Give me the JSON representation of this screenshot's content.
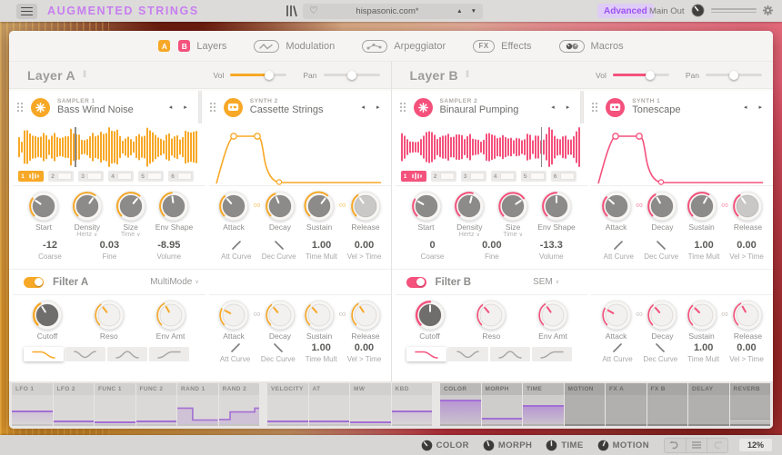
{
  "topbar": {
    "title": "AUGMENTED STRINGS",
    "menu_icon": "hamburger-icon",
    "library_icon": "library-icon",
    "preset": {
      "heart_icon": "heart-icon",
      "name": "hispasonic.com*"
    },
    "advanced_label": "Advanced",
    "main_out_label": "Main Out",
    "settings_icon": "gear-icon"
  },
  "tabs": [
    {
      "label": "Layers",
      "icon": "layers-ab-icon",
      "active": true
    },
    {
      "label": "Modulation",
      "icon": "modulation-icon",
      "active": false
    },
    {
      "label": "Arpeggiator",
      "icon": "arpeggiator-icon",
      "active": false
    },
    {
      "label": "Effects",
      "icon": "effects-fx-icon",
      "active": false
    },
    {
      "label": "Macros",
      "icon": "macros-icon",
      "active": false
    }
  ],
  "layers": {
    "a": {
      "accent": "#F7A827",
      "title": "Layer A",
      "vol_label": "Vol",
      "vol": 0.68,
      "pan_label": "Pan",
      "pan": 0.5,
      "sampler": {
        "type_label": "SAMPLER 1",
        "name": "Bass Wind Noise"
      },
      "synth": {
        "type_label": "SYNTH 2",
        "name": "Cassette Strings"
      },
      "playhead": 0.31,
      "slot_labels": [
        "1",
        "2",
        "3",
        "4",
        "5",
        "6"
      ],
      "selected_slot": 0,
      "main_knobs": [
        {
          "label": "Start",
          "angle": -55
        },
        {
          "label": "Density",
          "sub": "Hertz",
          "angle": 35
        },
        {
          "label": "Size",
          "sub": "Time",
          "angle": 40
        },
        {
          "label": "Env Shape",
          "angle": -8
        }
      ],
      "env_knobs": [
        {
          "label": "Attack",
          "angle": -42
        },
        {
          "label": "Decay",
          "angle": -22
        },
        {
          "label": "Sustain",
          "angle": 38
        },
        {
          "label": "Release",
          "angle": -35,
          "kind": "pale"
        }
      ],
      "values_left": [
        {
          "value": "-12",
          "label": "Coarse"
        },
        {
          "value": "0.03",
          "label": "Fine"
        },
        {
          "value": "-8.95",
          "label": "Volume"
        }
      ],
      "values_right": [
        {
          "glyph": "rise",
          "label": "Att Curve"
        },
        {
          "glyph": "fall",
          "label": "Dec Curve"
        },
        {
          "value": "1.00",
          "label": "Time Mult"
        },
        {
          "value": "0.00",
          "label": "Vel > Time"
        }
      ],
      "filter": {
        "label": "Filter A",
        "enabled": true,
        "mode": "MultiMode",
        "shapes": [
          "lowpass",
          "notch",
          "bandpass",
          "highpass"
        ],
        "selected_shape": 0,
        "knobs": [
          {
            "label": "Cutoff",
            "angle": -32,
            "kind": "cutoff"
          },
          {
            "label": "Reso",
            "angle": -38,
            "kind": "light"
          },
          {
            "label": "Env Amt",
            "angle": -30,
            "kind": "light"
          }
        ],
        "env_knobs": [
          {
            "label": "Attack",
            "angle": -62,
            "kind": "light"
          },
          {
            "label": "Decay",
            "angle": -40,
            "kind": "light"
          },
          {
            "label": "Sustain",
            "angle": -42,
            "kind": "light"
          },
          {
            "label": "Release",
            "angle": -33,
            "kind": "light"
          }
        ],
        "values": [
          {
            "glyph": "rise",
            "label": "Att Curve"
          },
          {
            "glyph": "fall",
            "label": "Dec Curve"
          },
          {
            "value": "1.00",
            "label": "Time Mult"
          },
          {
            "value": "0.00",
            "label": "Vel > Time"
          }
        ]
      }
    },
    "b": {
      "accent": "#F4517C",
      "title": "Layer B",
      "vol_label": "Vol",
      "vol": 0.66,
      "pan_label": "Pan",
      "pan": 0.5,
      "sampler": {
        "type_label": "SAMPLER 2",
        "name": "Binaural Pumping"
      },
      "synth": {
        "type_label": "SYNTH 1",
        "name": "Tonescape"
      },
      "playhead": 0.77,
      "slot_labels": [
        "1",
        "2",
        "3",
        "4",
        "5",
        "6"
      ],
      "selected_slot": 0,
      "main_knobs": [
        {
          "label": "Start",
          "angle": -60
        },
        {
          "label": "Density",
          "sub": "Hertz",
          "angle": 15
        },
        {
          "label": "Size",
          "sub": "Time",
          "angle": 55
        },
        {
          "label": "Env Shape",
          "angle": 0
        }
      ],
      "env_knobs": [
        {
          "label": "Attack",
          "angle": -48
        },
        {
          "label": "Decay",
          "angle": -30
        },
        {
          "label": "Sustain",
          "angle": 30
        },
        {
          "label": "Release",
          "angle": -35,
          "kind": "pale"
        }
      ],
      "values_left": [
        {
          "value": "0",
          "label": "Coarse"
        },
        {
          "value": "0.00",
          "label": "Fine"
        },
        {
          "value": "-13.3",
          "label": "Volume"
        }
      ],
      "values_right": [
        {
          "glyph": "rise",
          "label": "Att Curve"
        },
        {
          "glyph": "fall",
          "label": "Dec Curve"
        },
        {
          "value": "1.00",
          "label": "Time Mult"
        },
        {
          "value": "0.00",
          "label": "Vel > Time"
        }
      ],
      "filter": {
        "label": "Filter B",
        "enabled": true,
        "mode": "SEM",
        "shapes": [
          "lowpass",
          "notch",
          "bandpass",
          "highpass"
        ],
        "selected_shape": 0,
        "knobs": [
          {
            "label": "Cutoff",
            "angle": 0,
            "kind": "cutoff"
          },
          {
            "label": "Reso",
            "angle": -40,
            "kind": "light"
          },
          {
            "label": "Env Amt",
            "angle": -35,
            "kind": "light"
          }
        ],
        "env_knobs": [
          {
            "label": "Attack",
            "angle": -60,
            "kind": "light"
          },
          {
            "label": "Decay",
            "angle": -42,
            "kind": "light"
          },
          {
            "label": "Sustain",
            "angle": -45,
            "kind": "light"
          },
          {
            "label": "Release",
            "angle": -30,
            "kind": "light"
          }
        ],
        "values": [
          {
            "glyph": "rise",
            "label": "Att Curve"
          },
          {
            "glyph": "fall",
            "label": "Dec Curve"
          },
          {
            "value": "1.00",
            "label": "Time Mult"
          },
          {
            "value": "0.00",
            "label": "Vel > Time"
          }
        ]
      }
    }
  },
  "mod_strip": {
    "cells": [
      {
        "label": "LFO 1",
        "kind": "line",
        "level": 0.42
      },
      {
        "label": "LFO 2",
        "kind": "line",
        "level": 0.05
      },
      {
        "label": "FUNC 1",
        "kind": "line",
        "level": 0.04
      },
      {
        "label": "FUNC 2",
        "kind": "line",
        "level": 0.05
      },
      {
        "label": "RAND 1",
        "kind": "steps",
        "points": [
          [
            0,
            0.55
          ],
          [
            0.38,
            0.55
          ],
          [
            0.38,
            0.14
          ],
          [
            1,
            0.14
          ]
        ]
      },
      {
        "label": "RAND 2",
        "kind": "steps",
        "points": [
          [
            0,
            0.16
          ],
          [
            0.27,
            0.16
          ],
          [
            0.27,
            0.42
          ],
          [
            0.88,
            0.42
          ],
          [
            0.88,
            0.55
          ],
          [
            1,
            0.55
          ]
        ]
      },
      {
        "label": "VELOCITY",
        "kind": "line",
        "level": 0.05,
        "gap_before": true
      },
      {
        "label": "AT",
        "kind": "line",
        "level": 0.05
      },
      {
        "label": "MW",
        "kind": "line",
        "level": 0.03
      },
      {
        "label": "KBD",
        "kind": "line",
        "level": 0.42
      },
      {
        "label": "COLOR",
        "kind": "fill",
        "level": 0.78,
        "tone": "medium",
        "gap_before": true
      },
      {
        "label": "MORPH",
        "kind": "line",
        "level": 0.16,
        "tone": "medium"
      },
      {
        "label": "TIME",
        "kind": "fill",
        "level": 0.6,
        "tone": "medium"
      },
      {
        "label": "MOTION",
        "kind": "none",
        "tone": "dark"
      },
      {
        "label": "FX A",
        "kind": "none",
        "tone": "dark"
      },
      {
        "label": "FX B",
        "kind": "none",
        "tone": "dark"
      },
      {
        "label": "DELAY",
        "kind": "none",
        "tone": "dark"
      },
      {
        "label": "REVERB",
        "kind": "grayfill",
        "level": 0.2,
        "tone": "dark"
      }
    ]
  },
  "bottom_bar": {
    "macros": [
      {
        "label": "COLOR"
      },
      {
        "label": "MORPH"
      },
      {
        "label": "TIME"
      },
      {
        "label": "MOTION"
      }
    ],
    "undo_icon": "undo-arrow-icon",
    "menu_icon": "history-menu-icon",
    "redo_icon": "redo-arrow-icon",
    "cpu": "12%"
  }
}
